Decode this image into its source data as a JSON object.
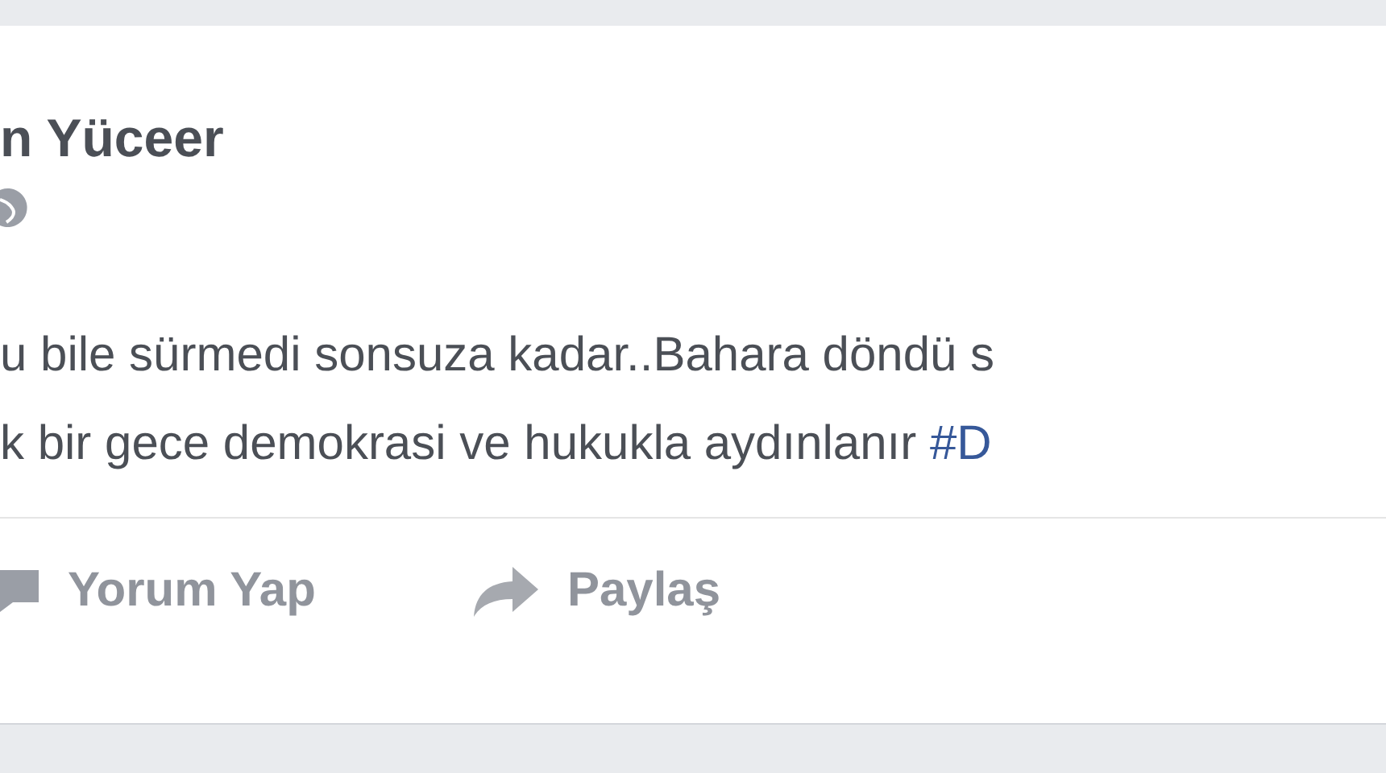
{
  "post": {
    "author": "n Yüceer",
    "lines": [
      "u bile sürmedi sonsuza kadar..Bahara döndü s",
      "k bir gece demokrasi ve hukukla aydınlanır "
    ],
    "hashtag": "#D",
    "actions": [
      {
        "kind": "comment",
        "label": "Yorum Yap"
      },
      {
        "kind": "share",
        "label": "Paylaş"
      }
    ]
  }
}
